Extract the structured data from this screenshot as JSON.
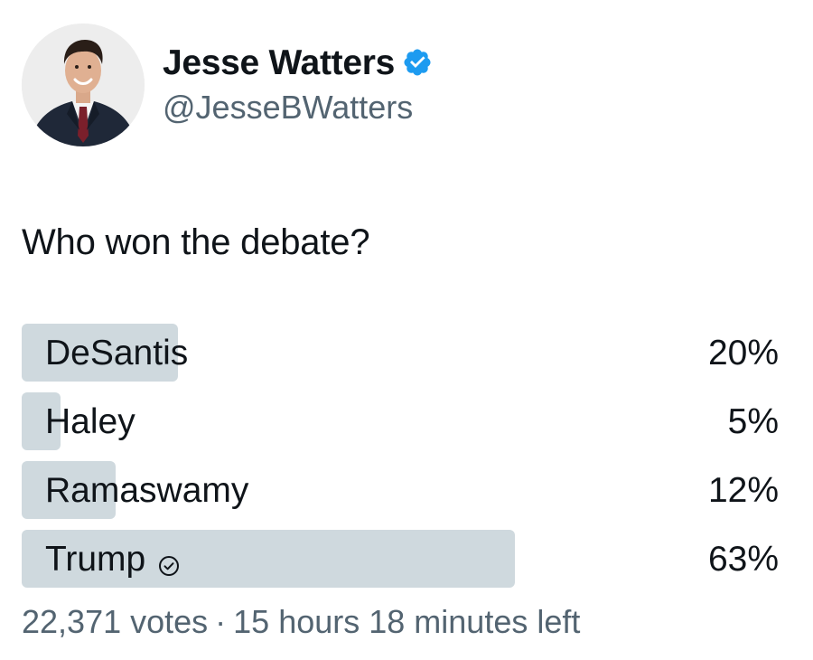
{
  "author": {
    "display_name": "Jesse Watters",
    "handle": "@JesseBWatters",
    "verified": true,
    "verified_icon": "verified-badge-icon",
    "avatar": "profile-photo"
  },
  "tweet": {
    "text": "Who won the debate?"
  },
  "poll": {
    "options": [
      {
        "label": "DeSantis",
        "percent_text": "20%",
        "percent": 20,
        "winner": false
      },
      {
        "label": "Haley",
        "percent_text": "5%",
        "percent": 5,
        "winner": false
      },
      {
        "label": "Ramaswamy",
        "percent_text": "12%",
        "percent": 12,
        "winner": false
      },
      {
        "label": "Trump",
        "percent_text": "63%",
        "percent": 63,
        "winner": true
      }
    ],
    "votes_text": "22,371 votes",
    "separator": "·",
    "time_left_text": "15 hours 18 minutes left",
    "bar_color": "#cfd9de",
    "winner_icon": "check-circle-icon"
  },
  "colors": {
    "text": "#0f1419",
    "secondary_text": "#536471",
    "verified_blue": "#1d9bf0"
  }
}
